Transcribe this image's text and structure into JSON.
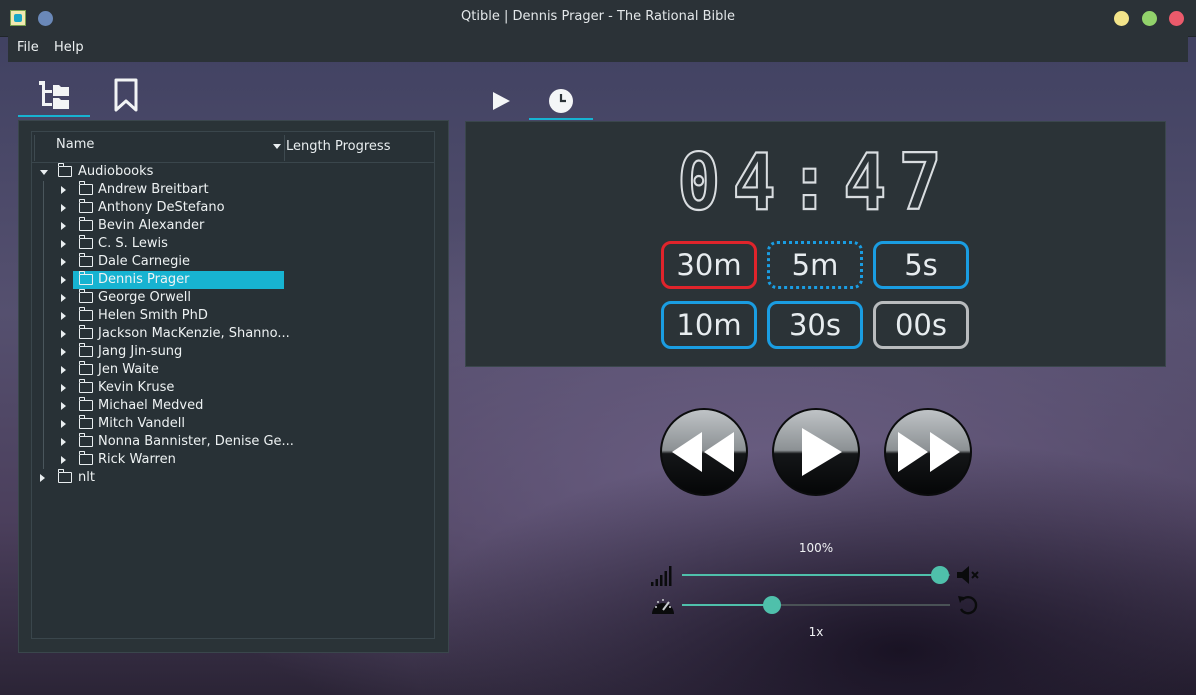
{
  "window": {
    "title": "Qtible | Dennis Prager - The Rational Bible"
  },
  "menu": [
    "File",
    "Help"
  ],
  "left_tabs": [
    {
      "name": "library-tab",
      "icon": "tree-icon"
    },
    {
      "name": "bookmarks-tab",
      "icon": "bookmark-icon"
    }
  ],
  "tree": {
    "columns": [
      "Name",
      "Length",
      "Progress"
    ],
    "root": "Audiobooks",
    "authors": [
      "Andrew Breitbart",
      "Anthony DeStefano",
      "Bevin Alexander",
      "C. S. Lewis",
      "Dale Carnegie",
      "Dennis Prager",
      "George Orwell",
      "Helen Smith PhD",
      "Jackson MacKenzie, Shanno...",
      "Jang Jin-sung",
      "Jen Waite",
      "Kevin Kruse",
      "Michael Medved",
      "Mitch Vandell",
      "Nonna Bannister, Denise Ge...",
      "Rick Warren"
    ],
    "selected": "Dennis Prager",
    "other_root": "nlt"
  },
  "right_tabs": [
    {
      "name": "player-tab",
      "icon": "play-icon"
    },
    {
      "name": "timer-tab",
      "icon": "clock-icon"
    }
  ],
  "timer": {
    "display": "04:47",
    "buttons": [
      "30m",
      "5m",
      "5s",
      "10m",
      "30s",
      "00s"
    ]
  },
  "controls": {
    "volume_label": "100%",
    "volume_level": 1.0,
    "speed_label": "1x",
    "speed_level": 0.35
  },
  "colors": {
    "accent": "#17b3d1",
    "slider": "#4fc0ab",
    "timer_active": "#e0242b",
    "timer_button": "#1a9de2"
  }
}
